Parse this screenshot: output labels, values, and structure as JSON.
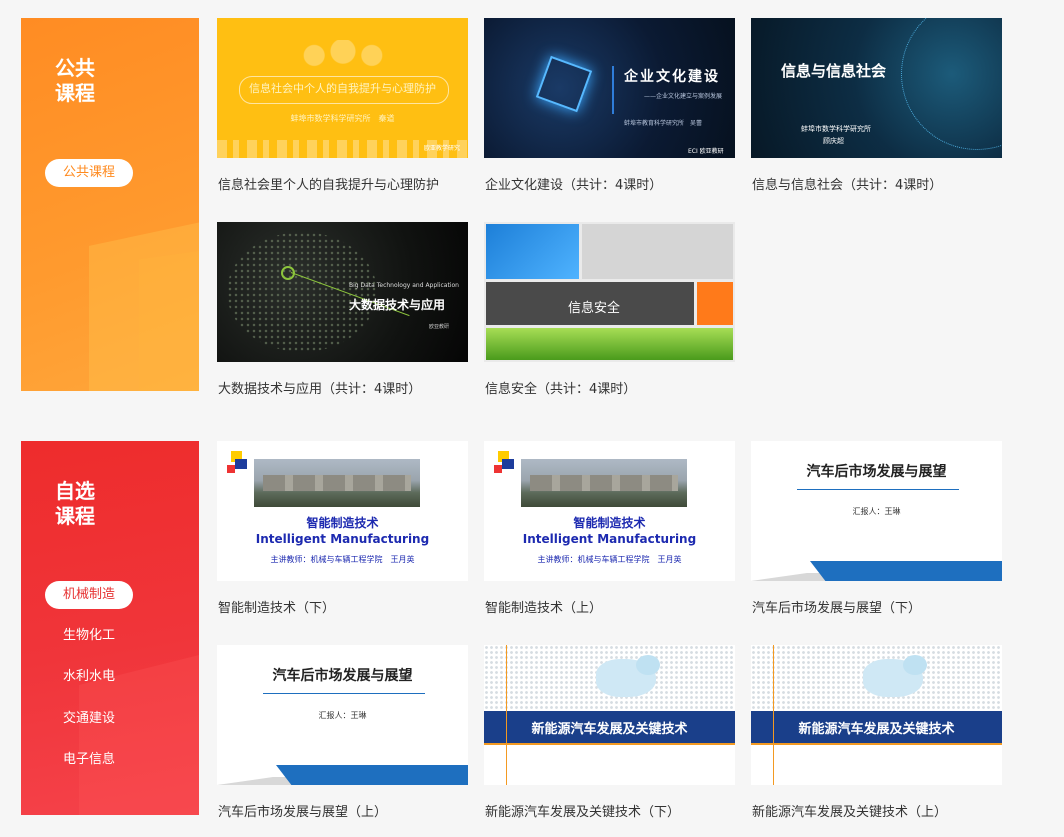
{
  "public": {
    "title_line1": "公共",
    "title_line2": "课程",
    "pill": "公共课程",
    "courses": [
      {
        "caption": "信息社会里个人的自我提升与心理防护",
        "thumb_title": "信息社会中个人的自我提升与心理防护",
        "thumb_sub": "蚌埠市数学科学研究所　秦道",
        "thumb_logo": "欧亚教学研究"
      },
      {
        "caption": "企业文化建设（共计：4课时）",
        "thumb_title": "企业文化建设",
        "thumb_sub": "——企业文化建立与案例发展",
        "thumb_author": "蚌埠市教育科学研究所　吴蕾",
        "thumb_logo": "ECI 欧亚教研"
      },
      {
        "caption": "信息与信息社会（共计：4课时）",
        "thumb_title": "信息与信息社会",
        "thumb_sub": "蚌埠市数学科学研究所",
        "thumb_sub2": "顾庆超"
      },
      {
        "caption": "大数据技术与应用（共计：4课时）",
        "thumb_en": "Big Data Technology and Application",
        "thumb_title": "大数据技术与应用",
        "thumb_logo": "欧亚教研"
      },
      {
        "caption": "信息安全（共计：4课时）",
        "thumb_title": "信息安全"
      }
    ]
  },
  "elective": {
    "title_line1": "自选",
    "title_line2": "课程",
    "categories": [
      "机械制造",
      "生物化工",
      "水利水电",
      "交通建设",
      "电子信息"
    ],
    "active_category": "机械制造",
    "courses": [
      {
        "caption": "智能制造技术（下）",
        "thumb_title": "智能制造技术",
        "thumb_en": "Intelligent Manufacturing",
        "thumb_teacher": "主讲教师：机械与车辆工程学院　王月英"
      },
      {
        "caption": "智能制造技术（上）",
        "thumb_title": "智能制造技术",
        "thumb_en": "Intelligent Manufacturing",
        "thumb_teacher": "主讲教师：机械与车辆工程学院　王月英"
      },
      {
        "caption": "汽车后市场发展与展望（下）",
        "thumb_title": "汽车后市场发展与展望",
        "thumb_reporter": "汇报人：王琳"
      },
      {
        "caption": "汽车后市场发展与展望（上）",
        "thumb_title": "汽车后市场发展与展望",
        "thumb_reporter": "汇报人：王琳"
      },
      {
        "caption": "新能源汽车发展及关键技术（下）",
        "thumb_title": "新能源汽车发展及关键技术"
      },
      {
        "caption": "新能源汽车发展及关键技术（上）",
        "thumb_title": "新能源汽车发展及关键技术"
      }
    ]
  },
  "colors": {
    "public_accent": "#ff8c23",
    "elective_accent": "#ee2c2c",
    "page_bg": "#f6f6f6"
  }
}
